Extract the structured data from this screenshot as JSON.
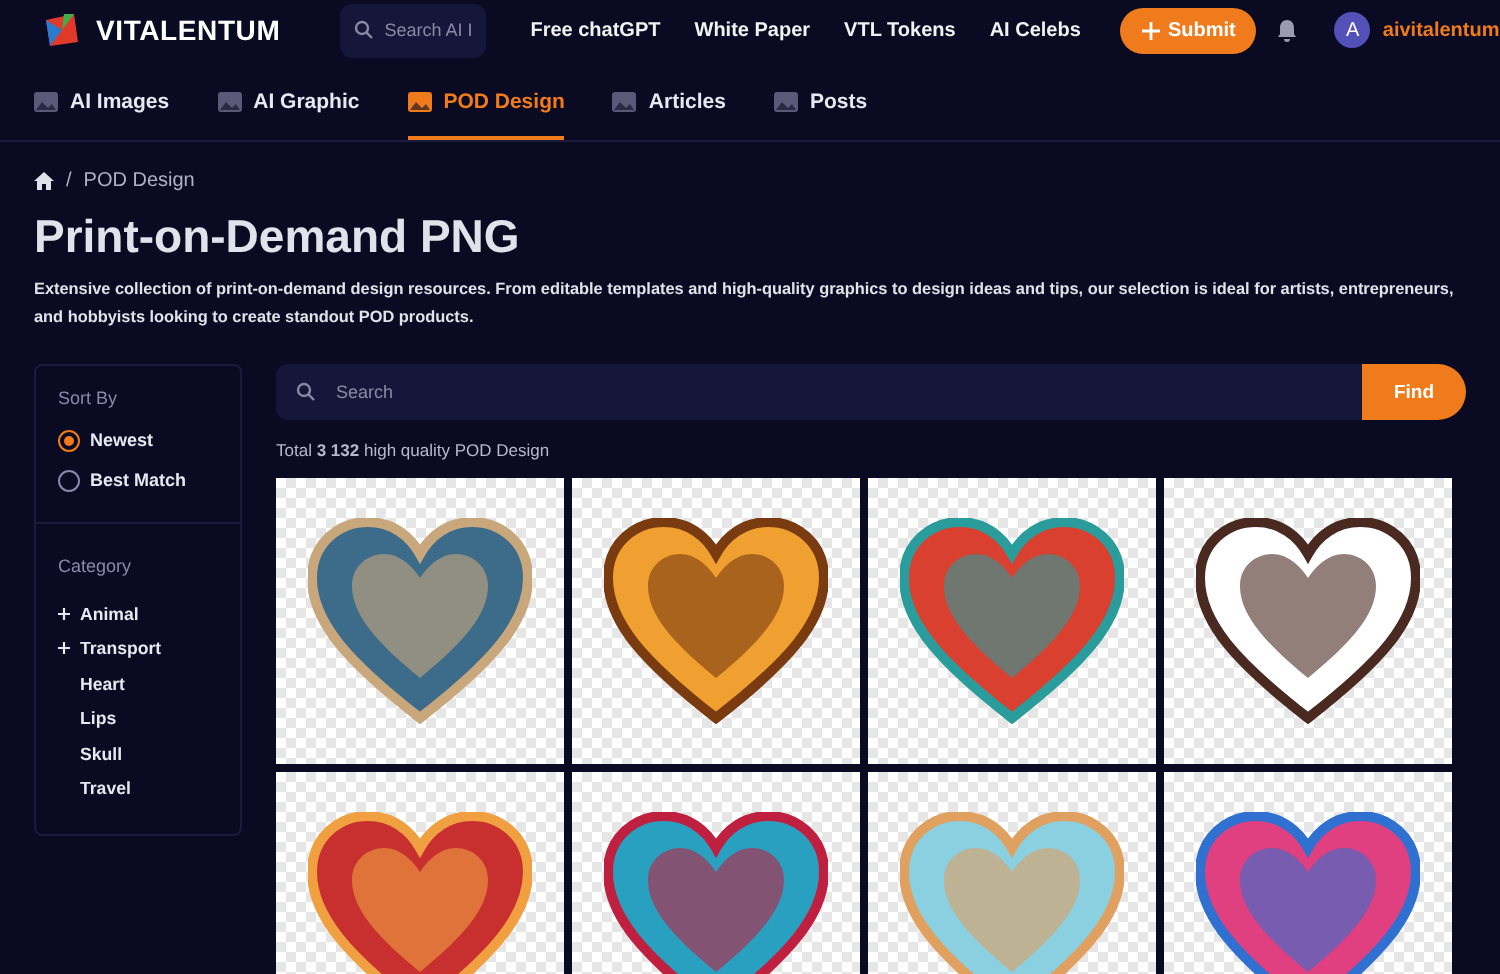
{
  "header": {
    "brand": "VITALENTUM",
    "search_placeholder": "Search AI I",
    "nav": [
      "Free chatGPT",
      "White Paper",
      "VTL Tokens",
      "AI Celebs"
    ],
    "submit": "Submit",
    "avatar_letter": "A",
    "username": "aivitalentum"
  },
  "tabs": [
    {
      "label": "AI Images",
      "selected": false
    },
    {
      "label": "AI Graphic",
      "selected": false
    },
    {
      "label": "POD Design",
      "selected": true
    },
    {
      "label": "Articles",
      "selected": false
    },
    {
      "label": "Posts",
      "selected": false
    }
  ],
  "breadcrumb_separator": "/",
  "breadcrumb": "POD Design",
  "title": "Print-on-Demand PNG",
  "description": "Extensive collection of print-on-demand design resources. From editable templates and high-quality graphics to design ideas and tips, our selection is ideal for artists, entrepreneurs, and hobbyists looking to create standout POD products.",
  "sidebar": {
    "sort_title": "Sort By",
    "sort_options": [
      {
        "label": "Newest",
        "selected": true
      },
      {
        "label": "Best Match",
        "selected": false
      }
    ],
    "category_title": "Category",
    "categories": [
      {
        "label": "Animal",
        "expandable": true
      },
      {
        "label": "Transport",
        "expandable": true
      },
      {
        "label": "Heart",
        "expandable": false
      },
      {
        "label": "Lips",
        "expandable": false
      },
      {
        "label": "Skull",
        "expandable": false
      },
      {
        "label": "Travel",
        "expandable": false
      }
    ]
  },
  "search": {
    "placeholder": "Search",
    "button": "Find"
  },
  "total": "Total **3 132** high quality POD Design"
}
